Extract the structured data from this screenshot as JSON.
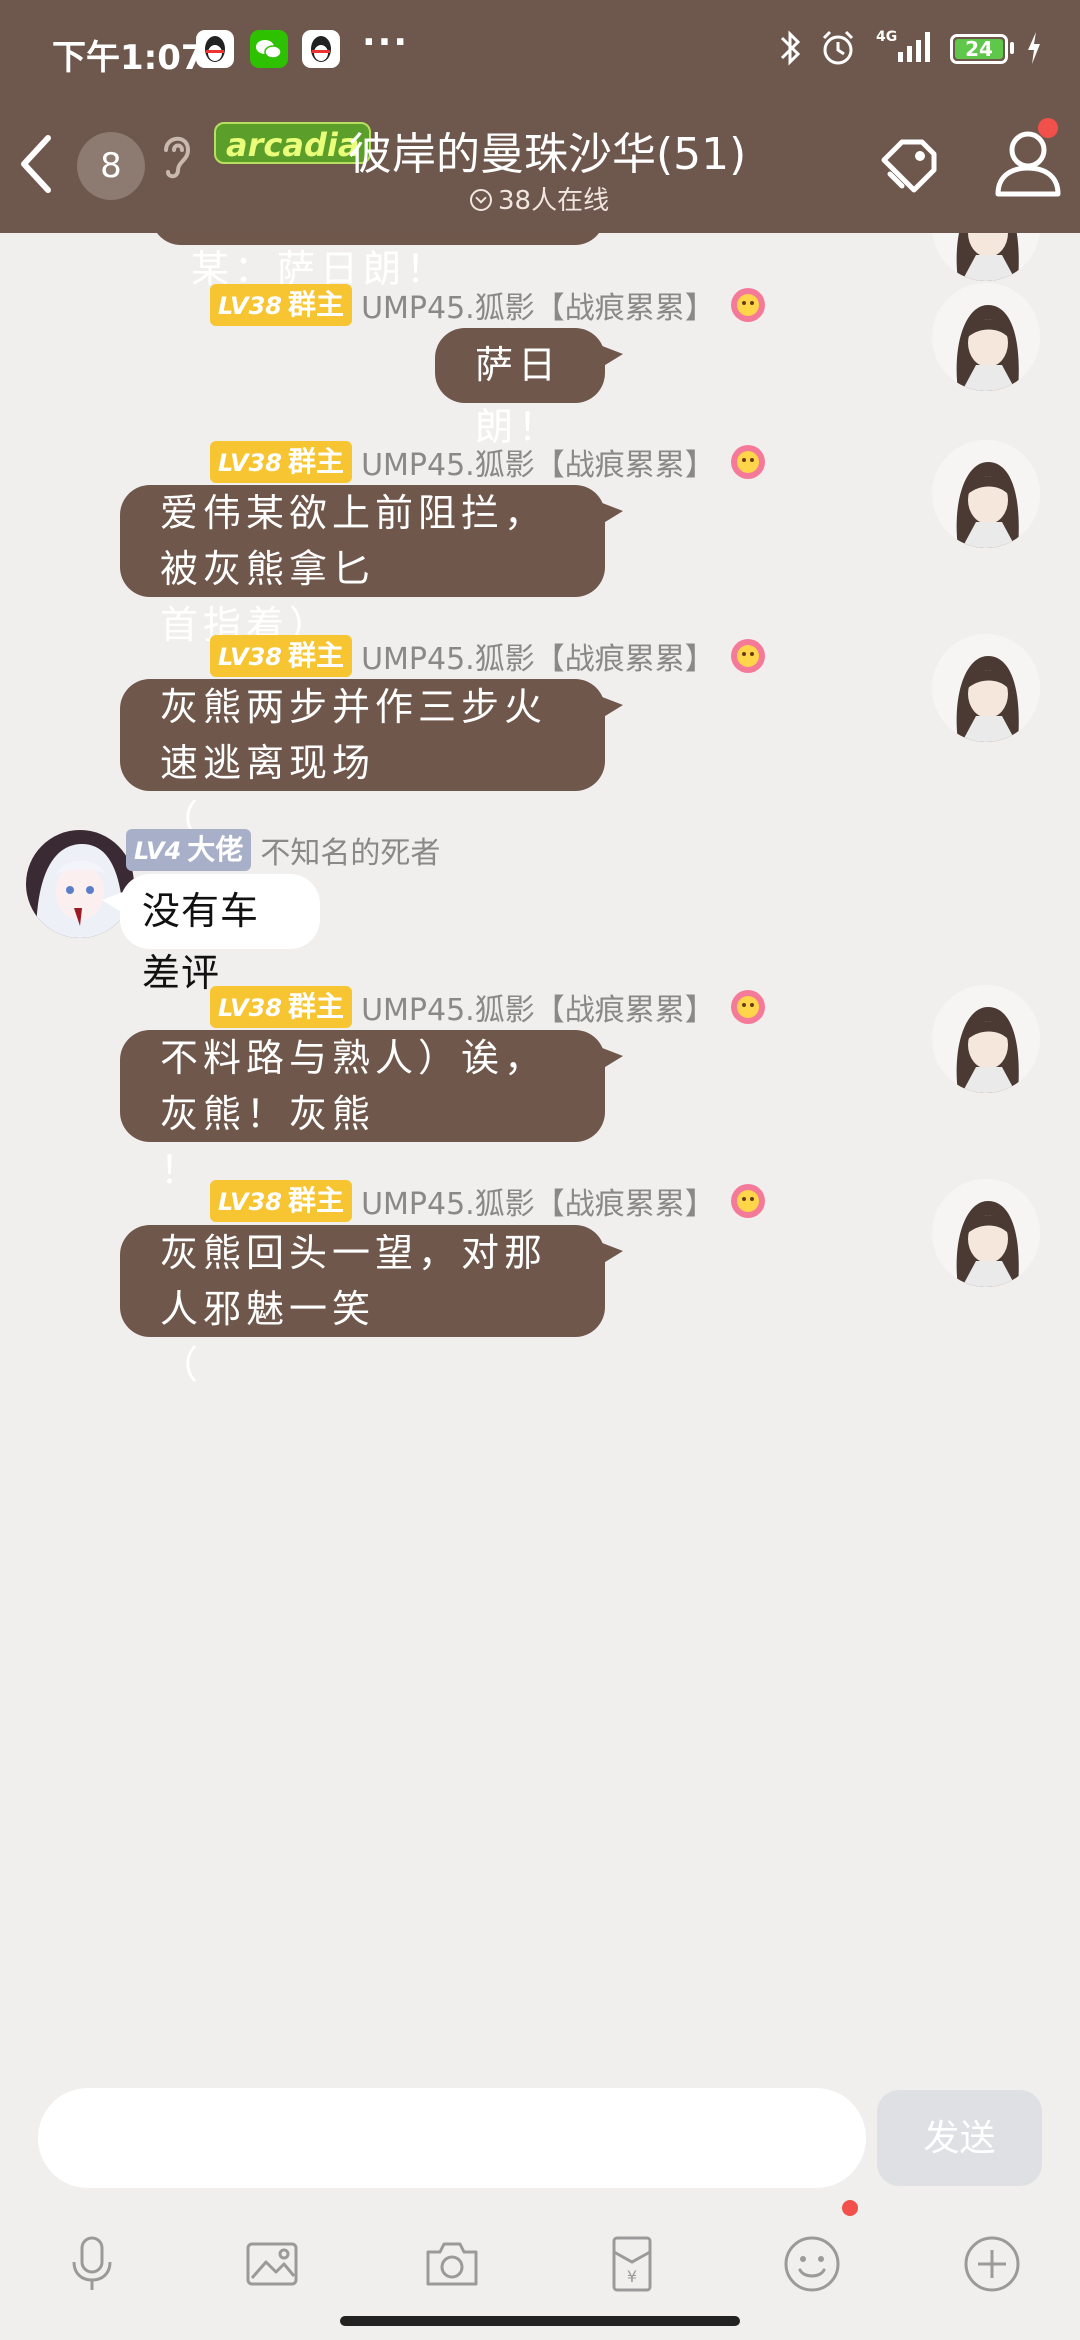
{
  "status_bar": {
    "time": "下午1:07",
    "more": "···",
    "network": "4G",
    "battery": "24",
    "icons": [
      "qq-icon",
      "wechat-icon",
      "qq-icon",
      "bluetooth-icon",
      "alarm-icon",
      "signal-icon",
      "battery-icon",
      "charging-icon"
    ]
  },
  "header": {
    "unread_count": "8",
    "group_badge": "arcadia",
    "group_name": "彼岸的曼珠沙华(51)",
    "online_text": "38人在线",
    "icons": [
      "back-icon",
      "earpiece-icon",
      "tag-icon",
      "members-icon"
    ]
  },
  "messages": [
    {
      "side": "right",
      "level": "",
      "role": "",
      "nick": "",
      "lines": [
        "隔壁精炼酱爱伟某：萨日朗！"
      ]
    },
    {
      "side": "right",
      "level": "LV38",
      "role": "群主",
      "nick": "UMP45.狐影【战痕累累】",
      "lines": [
        "萨日朗！"
      ]
    },
    {
      "side": "right",
      "level": "LV38",
      "role": "群主",
      "nick": "UMP45.狐影【战痕累累】",
      "lines": [
        "爱伟某欲上前阻拦，被灰熊拿匕",
        "首指着）"
      ]
    },
    {
      "side": "right",
      "level": "LV38",
      "role": "群主",
      "nick": "UMP45.狐影【战痕累累】",
      "lines": [
        "灰熊两步并作三步火速逃离现场",
        "（"
      ]
    },
    {
      "side": "left",
      "level": "LV4",
      "role": "大佬",
      "nick": "不知名的死者",
      "lines": [
        "没有车差评"
      ]
    },
    {
      "side": "right",
      "level": "LV38",
      "role": "群主",
      "nick": "UMP45.狐影【战痕累累】",
      "lines": [
        "不料路与熟人）诶，灰熊！灰熊",
        "！"
      ]
    },
    {
      "side": "right",
      "level": "LV38",
      "role": "群主",
      "nick": "UMP45.狐影【战痕累累】",
      "lines": [
        "灰熊回头一望，对那人邪魅一笑",
        "（"
      ]
    }
  ],
  "input": {
    "placeholder": "",
    "value": "",
    "send_label": "发送"
  },
  "toolbar": {
    "tools": [
      "microphone-icon",
      "image-icon",
      "camera-icon",
      "red-packet-icon",
      "emoji-icon",
      "plus-icon"
    ]
  },
  "colors": {
    "header_bg": "#6e574c",
    "bubble": "#6f574b",
    "chat_bg": "#f1efee",
    "level_owner": "#f7c531",
    "level_member": "#a8afc8",
    "badge_green": "#5b9e2a"
  }
}
